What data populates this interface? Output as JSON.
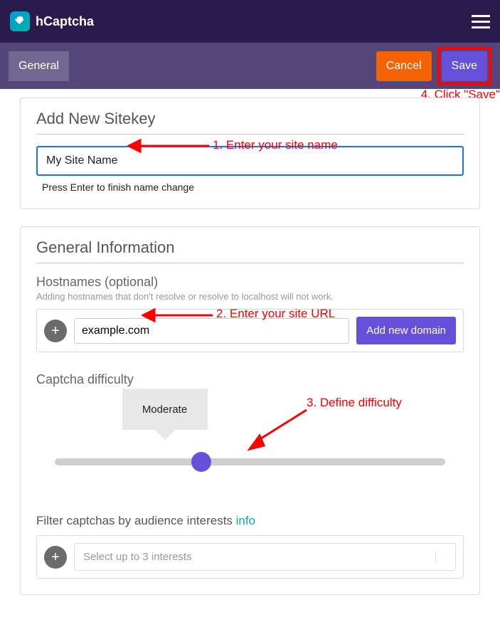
{
  "header": {
    "brand": "hCaptcha"
  },
  "subheader": {
    "tab_general": "General",
    "cancel_label": "Cancel",
    "save_label": "Save"
  },
  "annotations": {
    "step1": "1. Enter your site name",
    "step2": "2. Enter your site URL",
    "step3": "3. Define difficulty",
    "step4": "4. Click \"Save\""
  },
  "sitekey_card": {
    "title": "Add New Sitekey",
    "name_value": "My Site Name",
    "name_helper": "Press Enter to finish name change"
  },
  "general_card": {
    "title": "General Information",
    "hostnames_label": "Hostnames (optional)",
    "hostnames_sub": "Adding hostnames that don't resolve or resolve to localhost will not work.",
    "domain_value": "example.com",
    "add_domain_label": "Add new domain",
    "difficulty_label": "Captcha difficulty",
    "difficulty_value": "Moderate",
    "filter_label": "Filter captchas by audience interests ",
    "filter_info": "info",
    "filter_placeholder": "Select up to 3 interests"
  }
}
